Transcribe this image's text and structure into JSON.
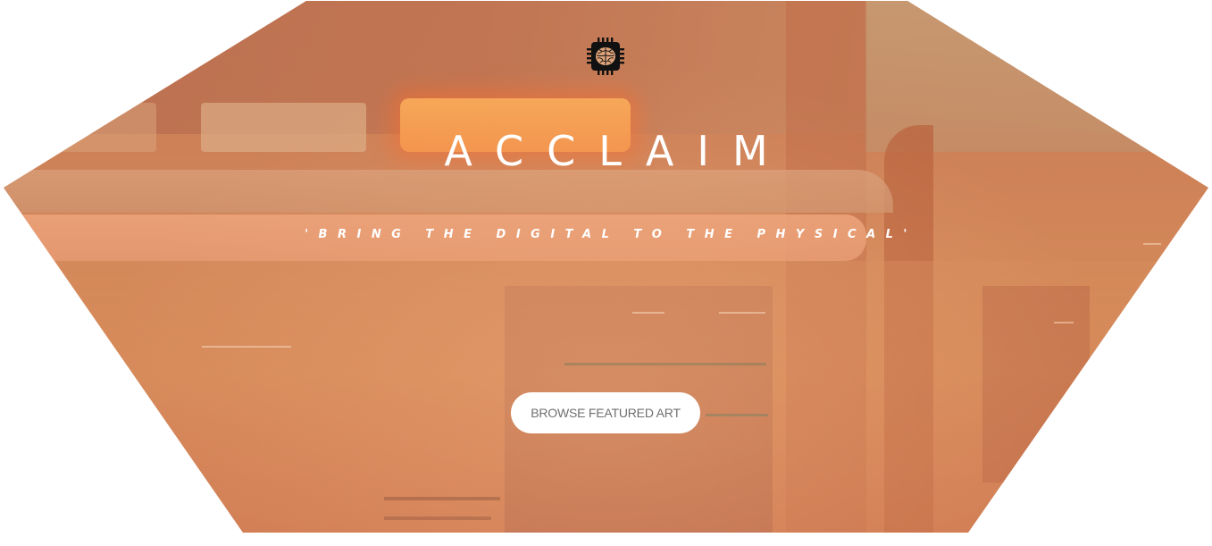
{
  "hero": {
    "title": "ACCLAIM",
    "tagline": "'BRING THE DIGITAL TO THE PHYSICAL'",
    "cta_label": "BROWSE FEATURED ART",
    "logo_icon": "chip-brain-icon"
  },
  "colors": {
    "hero_tint": "#d08458",
    "glow": "#f3934b",
    "title_text": "#ffffff",
    "button_bg": "#ffffff",
    "button_text": "#6f6f6f"
  }
}
